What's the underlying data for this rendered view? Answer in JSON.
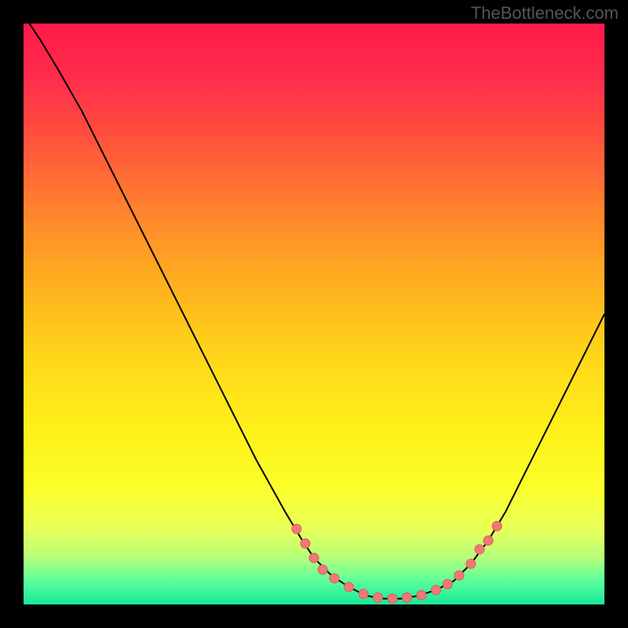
{
  "watermark": "TheBottleneck.com",
  "colors": {
    "curve": "#000000",
    "dot_fill": "#f07878",
    "dot_stroke": "#e05a5a"
  },
  "chart_data": {
    "type": "line",
    "title": "",
    "xlabel": "",
    "ylabel": "",
    "xlim": [
      0,
      100
    ],
    "ylim": [
      0,
      100
    ],
    "curve": [
      {
        "x": 1,
        "y": 100
      },
      {
        "x": 3,
        "y": 97
      },
      {
        "x": 6,
        "y": 92
      },
      {
        "x": 10,
        "y": 85
      },
      {
        "x": 15,
        "y": 75
      },
      {
        "x": 20,
        "y": 65
      },
      {
        "x": 25,
        "y": 55
      },
      {
        "x": 30,
        "y": 45
      },
      {
        "x": 35,
        "y": 35
      },
      {
        "x": 40,
        "y": 25
      },
      {
        "x": 45,
        "y": 16
      },
      {
        "x": 48,
        "y": 11
      },
      {
        "x": 50,
        "y": 8
      },
      {
        "x": 53,
        "y": 5
      },
      {
        "x": 56,
        "y": 3
      },
      {
        "x": 59,
        "y": 1.5
      },
      {
        "x": 62,
        "y": 1
      },
      {
        "x": 65,
        "y": 1
      },
      {
        "x": 68,
        "y": 1.5
      },
      {
        "x": 71,
        "y": 2.5
      },
      {
        "x": 74,
        "y": 4
      },
      {
        "x": 77,
        "y": 7
      },
      {
        "x": 80,
        "y": 11
      },
      {
        "x": 83,
        "y": 16
      },
      {
        "x": 86,
        "y": 22
      },
      {
        "x": 89,
        "y": 28
      },
      {
        "x": 92,
        "y": 34
      },
      {
        "x": 95,
        "y": 40
      },
      {
        "x": 98,
        "y": 46
      },
      {
        "x": 100,
        "y": 50
      }
    ],
    "highlight_points": [
      {
        "x": 47,
        "y": 13
      },
      {
        "x": 48.5,
        "y": 10.5
      },
      {
        "x": 50,
        "y": 8
      },
      {
        "x": 51.5,
        "y": 6
      },
      {
        "x": 53.5,
        "y": 4.5
      },
      {
        "x": 56,
        "y": 3
      },
      {
        "x": 58.5,
        "y": 1.8
      },
      {
        "x": 61,
        "y": 1.2
      },
      {
        "x": 63.5,
        "y": 1
      },
      {
        "x": 66,
        "y": 1.2
      },
      {
        "x": 68.5,
        "y": 1.6
      },
      {
        "x": 71,
        "y": 2.5
      },
      {
        "x": 73,
        "y": 3.5
      },
      {
        "x": 75,
        "y": 5
      },
      {
        "x": 77,
        "y": 7
      },
      {
        "x": 78.5,
        "y": 9.5
      },
      {
        "x": 80,
        "y": 11
      },
      {
        "x": 81.5,
        "y": 13.5
      }
    ],
    "dot_radius": 6
  }
}
